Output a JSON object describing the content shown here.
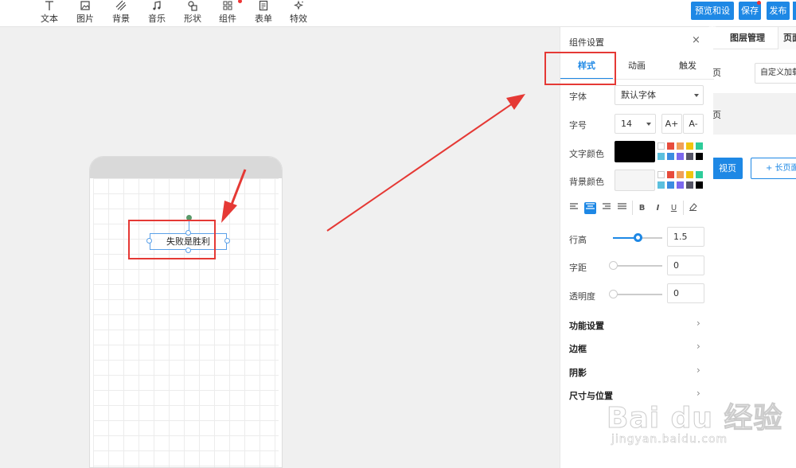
{
  "toolbar": {
    "items": [
      {
        "label": "文本",
        "icon": "text-icon"
      },
      {
        "label": "图片",
        "icon": "image-icon"
      },
      {
        "label": "背景",
        "icon": "background-icon"
      },
      {
        "label": "音乐",
        "icon": "music-icon"
      },
      {
        "label": "形状",
        "icon": "shape-icon"
      },
      {
        "label": "组件",
        "icon": "component-icon"
      },
      {
        "label": "表单",
        "icon": "form-icon"
      },
      {
        "label": "特效",
        "icon": "effects-icon"
      }
    ],
    "actions": {
      "preview_settings": "预览和设置",
      "save": "保存",
      "publish": "发布"
    }
  },
  "canvas": {
    "text_element": "失败是胜利"
  },
  "right_panel": {
    "tab_layers": "图层管理",
    "tab_page": "页面",
    "row_label": "页",
    "custom_load": "自定义加载",
    "band_label": "页",
    "blue_button": "视页",
    "long_page_button": "+ 长页面"
  },
  "settings": {
    "title": "组件设置",
    "close": "×",
    "tabs": {
      "style": "样式",
      "animation": "动画",
      "trigger": "触发"
    },
    "font_label": "字体",
    "font_value": "默认字体",
    "size_label": "字号",
    "size_value": "14",
    "size_up": "A+",
    "size_down": "A-",
    "text_color_label": "文字颜色",
    "text_color": "#000000",
    "bg_color_label": "背景颜色",
    "bg_color": "#f5f5f5",
    "palette": [
      "#ffffff",
      "#e74c3c",
      "#f0a05a",
      "#f1c40f",
      "#2ecc9a",
      "#5bc0de",
      "#3b8de0",
      "#7b68ee",
      "#555566",
      "#000000"
    ],
    "format": {
      "bold": "B",
      "italic": "I",
      "underline": "U"
    },
    "line_height_label": "行高",
    "line_height_value": "1.5",
    "letter_spacing_label": "字距",
    "letter_spacing_value": "0",
    "opacity_label": "透明度",
    "opacity_value": "0",
    "sections": [
      "功能设置",
      "边框",
      "阴影",
      "尺寸与位置"
    ]
  },
  "watermark": {
    "brand": "Bai du 经验",
    "url": "jingyan.baidu.com"
  },
  "colors": {
    "accent": "#1e88e5",
    "annotation": "#e53935"
  }
}
